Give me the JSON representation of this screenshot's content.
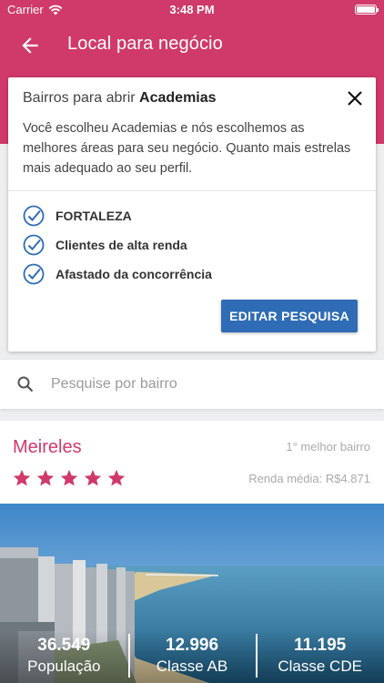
{
  "status_bar": {
    "carrier": "Carrier",
    "time": "3:48 PM"
  },
  "app_bar": {
    "title": "Local para negócio"
  },
  "info_card": {
    "heading_prefix": "Bairros para abrir ",
    "heading_bold": "Academias",
    "description": "Você escolheu Academias e nós escolhemos as melhores áreas para seu negócio. Quanto mais estrelas mais adequado ao seu perfil.",
    "criteria": [
      "FORTALEZA",
      "Clientes de alta renda",
      "Afastado da concorrência"
    ],
    "edit_button": "EDITAR PESQUISA"
  },
  "search": {
    "placeholder": "Pesquise por bairro",
    "value": ""
  },
  "result": {
    "name": "Meireles",
    "rank": "1° melhor bairro",
    "stars": 5,
    "income": "Renda média: R$4.871",
    "stats": [
      {
        "value": "36.549",
        "label": "População"
      },
      {
        "value": "12.996",
        "label": "Classe AB"
      },
      {
        "value": "11.195",
        "label": "Classe CDE"
      }
    ]
  },
  "colors": {
    "primary": "#cf3a6b",
    "button": "#2f6cb5",
    "check": "#2f6cb5"
  }
}
